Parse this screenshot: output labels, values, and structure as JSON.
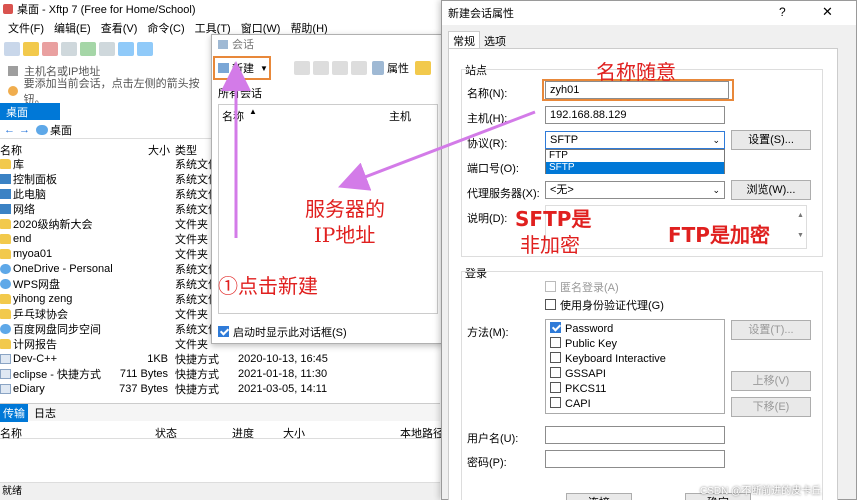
{
  "main": {
    "title": "桌面 - Xftp 7 (Free for Home/School)",
    "menu": [
      "文件(F)",
      "编辑(E)",
      "查看(V)",
      "命令(C)",
      "工具(T)",
      "窗口(W)",
      "帮助(H)"
    ],
    "host_placeholder": "主机名或IP地址",
    "hint": "要添加当前会话，点击左侧的箭头按钮。",
    "tab": "桌面",
    "path": "桌面",
    "columns": {
      "name": "名称",
      "size": "大小",
      "type": "类型"
    },
    "files": [
      {
        "name": "库",
        "size": "",
        "type": "系统文件",
        "modified": "",
        "icon": "folder"
      },
      {
        "name": "控制面板",
        "size": "",
        "type": "系统文件",
        "modified": "",
        "icon": "blue"
      },
      {
        "name": "此电脑",
        "size": "",
        "type": "系统文件",
        "modified": "",
        "icon": "blue"
      },
      {
        "name": "网络",
        "size": "",
        "type": "系统文件",
        "modified": "",
        "icon": "blue"
      },
      {
        "name": "2020级纳新大会",
        "size": "",
        "type": "文件夹",
        "modified": "",
        "icon": "folder"
      },
      {
        "name": "end",
        "size": "",
        "type": "文件夹",
        "modified": "",
        "icon": "folder"
      },
      {
        "name": "myoa01",
        "size": "",
        "type": "文件夹",
        "modified": "",
        "icon": "folder"
      },
      {
        "name": "OneDrive - Personal",
        "size": "",
        "type": "系统文件",
        "modified": "",
        "icon": "cloud"
      },
      {
        "name": "WPS网盘",
        "size": "",
        "type": "系统文件",
        "modified": "",
        "icon": "cloud"
      },
      {
        "name": "yihong zeng",
        "size": "",
        "type": "系统文件",
        "modified": "",
        "icon": "folder"
      },
      {
        "name": "乒乓球协会",
        "size": "",
        "type": "文件夹",
        "modified": "",
        "icon": "folder"
      },
      {
        "name": "百度网盘同步空间",
        "size": "",
        "type": "系统文件",
        "modified": "",
        "icon": "cloud"
      },
      {
        "name": "计网报告",
        "size": "",
        "type": "文件夹",
        "modified": "",
        "icon": "folder"
      },
      {
        "name": "Dev-C++",
        "size": "1KB",
        "type": "快捷方式",
        "modified": "2020-10-13, 16:45",
        "icon": "doc"
      },
      {
        "name": "eclipse - 快捷方式",
        "size": "711 Bytes",
        "type": "快捷方式",
        "modified": "2021-01-18, 11:30",
        "icon": "doc"
      },
      {
        "name": "eDiary",
        "size": "737 Bytes",
        "type": "快捷方式",
        "modified": "2021-03-05, 14:11",
        "icon": "doc"
      }
    ],
    "bottom_tabs": [
      "传输",
      "日志"
    ],
    "transfer_columns": [
      "名称",
      "状态",
      "进度",
      "大小",
      "本地路径"
    ],
    "status": "就绪"
  },
  "session_window": {
    "title": "会话",
    "new_button": "新建",
    "properties_button": "属性",
    "tree_root": "所有会话",
    "col_name": "名称",
    "col_host": "主机",
    "startup_checkbox": "启动时显示此对话框(S)"
  },
  "dialog": {
    "title": "新建会话属性",
    "tabs": [
      "常规",
      "选项"
    ],
    "group_site": "站点",
    "name_label": "名称(N):",
    "name_value": "zyh01",
    "host_label": "主机(H):",
    "host_value": "192.168.88.129",
    "protocol_label": "协议(R):",
    "protocol_value": "SFTP",
    "protocol_options": [
      "FTP",
      "SFTP"
    ],
    "settings_button": "设置(S)...",
    "port_label": "端口号(O):",
    "proxy_label": "代理服务器(X):",
    "proxy_value": "<无>",
    "browse_button": "浏览(W)...",
    "desc_label": "说明(D):",
    "group_login": "登录",
    "anon_login": "匿名登录(A)",
    "use_agent": "使用身份验证代理(G)",
    "method_label": "方法(M):",
    "methods": [
      {
        "label": "Password",
        "checked": true
      },
      {
        "label": "Public Key",
        "checked": false
      },
      {
        "label": "Keyboard Interactive",
        "checked": false
      },
      {
        "label": "GSSAPI",
        "checked": false
      },
      {
        "label": "PKCS11",
        "checked": false
      },
      {
        "label": "CAPI",
        "checked": false
      }
    ],
    "method_settings": "设置(T)...",
    "move_up": "上移(V)",
    "move_down": "下移(E)",
    "user_label": "用户名(U):",
    "pass_label": "密码(P):",
    "ok_button": "连接",
    "cancel_button": "确定"
  },
  "annotations": {
    "name_note": "名称随意",
    "server_ip_line1": "服务器的",
    "server_ip_line2": "IP地址",
    "click_new": "①点击新建",
    "sftp_line1": "SFTP是",
    "sftp_line2": "非加密",
    "ftp_note": "FTP是加密"
  },
  "watermark": "CSDN @不断前进的皮卡丘",
  "colors": {
    "annotation_red": "#e0201f",
    "arrow_purple": "#d37be8",
    "highlight_orange": "#e8883a",
    "selection_blue": "#0078d7"
  }
}
